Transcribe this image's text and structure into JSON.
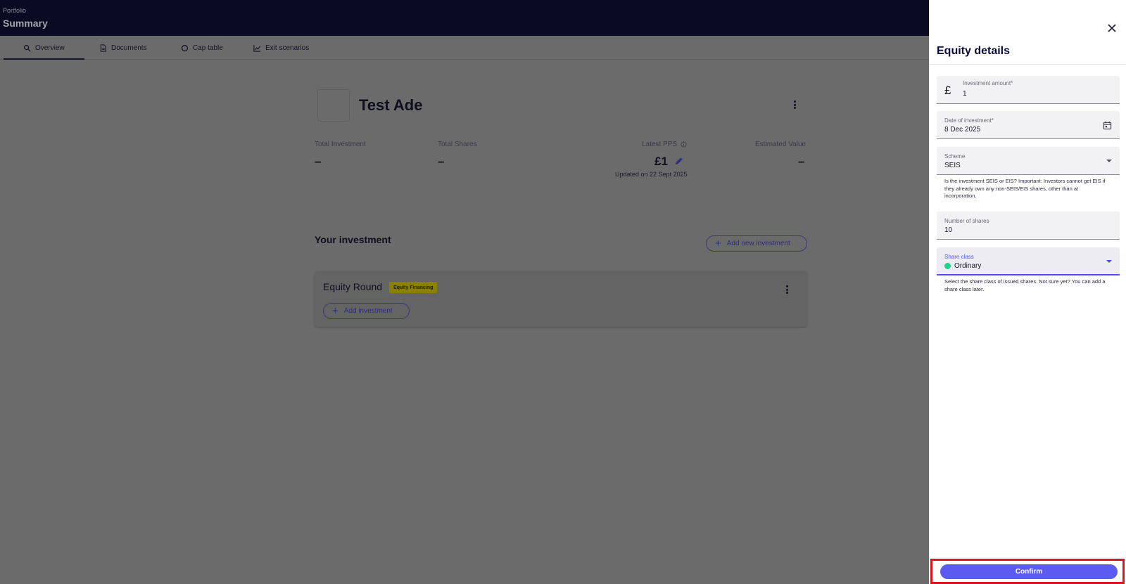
{
  "header": {
    "breadcrumb": "Portfolio",
    "title": "Summary"
  },
  "tabs": [
    {
      "label": "Overview",
      "icon": "search-icon",
      "active": true
    },
    {
      "label": "Documents",
      "icon": "document-icon",
      "active": false
    },
    {
      "label": "Cap table",
      "icon": "pie-chart-icon",
      "active": false
    },
    {
      "label": "Exit scenarios",
      "icon": "line-chart-icon",
      "active": false
    }
  ],
  "company": {
    "name": "Test Ade"
  },
  "stats": {
    "total_investment": {
      "label": "Total Investment",
      "value": "–"
    },
    "total_shares": {
      "label": "Total Shares",
      "value": "–"
    },
    "latest_pps": {
      "label": "Latest PPS",
      "value": "£1",
      "updated": "Updated on 22 Sept 2025"
    },
    "estimated_value": {
      "label": "Estimated Value",
      "value": "–"
    }
  },
  "investment": {
    "section_title": "Your investment",
    "add_new_label": "Add new investment",
    "round": {
      "title": "Equity Round",
      "badge": "Equity Financing",
      "add_label": "Add investment"
    }
  },
  "drawer": {
    "title": "Equity details",
    "fields": {
      "amount": {
        "currency": "£",
        "label": "Investment amount*",
        "value": "1"
      },
      "date": {
        "label": "Date of investment*",
        "value": "8 Dec 2025"
      },
      "scheme": {
        "label": "Scheme",
        "value": "SEIS",
        "helper": "Is the investment SEIS or EIS? Important: Investors cannot get EIS if they already own any non-SEIS/EIS shares, other than at incorporation."
      },
      "shares": {
        "label": "Number of shares",
        "value": "10"
      },
      "share_class": {
        "label": "Share class",
        "value": "Ordinary",
        "helper": "Select the share class of issued shares. Not sure yet? You can add a share class later."
      }
    },
    "confirm_label": "Confirm"
  },
  "colors": {
    "overlay": "#6b6b6b",
    "topbar": "#0a0a22",
    "accent": "#5b5bf2",
    "highlight": "#e0141e",
    "share_class_dot": "#22d38a",
    "badge": "#8c8000"
  }
}
